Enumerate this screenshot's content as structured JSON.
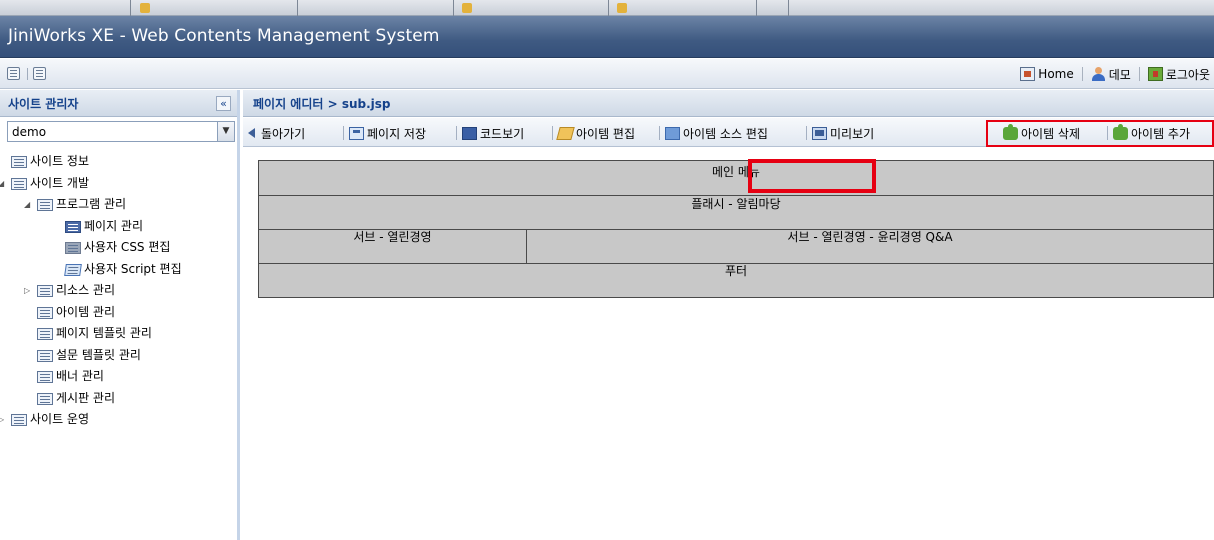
{
  "window": {
    "title": "JiniWorks XE - Web Contents Management System"
  },
  "topnav": {
    "home": "Home",
    "user": "데모",
    "logout": "로그아웃"
  },
  "left_panel": {
    "title": "사이트 관리자",
    "site_select": {
      "value": "demo"
    },
    "tree": [
      {
        "label": "사이트 정보",
        "level": 0,
        "expander": "none",
        "icon": "list-icon"
      },
      {
        "label": "사이트 개발",
        "level": 0,
        "expander": "expanded",
        "icon": "list-icon"
      },
      {
        "label": "프로그램 관리",
        "level": 1,
        "expander": "expanded",
        "icon": "list-icon"
      },
      {
        "label": "페이지 관리",
        "level": 2,
        "expander": "none",
        "icon": "page-icon"
      },
      {
        "label": "사용자 CSS 편집",
        "level": 2,
        "expander": "none",
        "icon": "css-icon"
      },
      {
        "label": "사용자 Script 편집",
        "level": 2,
        "expander": "none",
        "icon": "script-icon"
      },
      {
        "label": "리소스 관리",
        "level": 1,
        "expander": "collapsed",
        "icon": "list-icon"
      },
      {
        "label": "아이템 관리",
        "level": 1,
        "expander": "none",
        "icon": "list-icon"
      },
      {
        "label": "페이지 템플릿 관리",
        "level": 1,
        "expander": "none",
        "icon": "list-icon"
      },
      {
        "label": "설문 템플릿 관리",
        "level": 1,
        "expander": "none",
        "icon": "list-icon"
      },
      {
        "label": "배너 관리",
        "level": 1,
        "expander": "none",
        "icon": "list-icon"
      },
      {
        "label": "게시판 관리",
        "level": 1,
        "expander": "none",
        "icon": "list-icon"
      },
      {
        "label": "사이트 운영",
        "level": 0,
        "expander": "collapsed",
        "icon": "list-icon"
      }
    ]
  },
  "right_panel": {
    "title": "페이지 에디터 > sub.jsp",
    "toolbar": {
      "back": "돌아가기",
      "save": "페이지 저장",
      "code_view": "코드보기",
      "item_edit": "아이템 편집",
      "item_source_edit": "아이템 소스 편집",
      "preview": "미리보기",
      "item_delete": "아이템 삭제",
      "item_add": "아이템 추가"
    },
    "layout": {
      "main_menu": "메인 메뉴",
      "flash": "플래시 - 알림마당",
      "sub_left": "서브 - 열린경영",
      "sub_right": "서브 - 열린경영 - 윤리경영 Q&A",
      "footer": "푸터"
    }
  },
  "colors": {
    "title_bar": "#3f5a82",
    "panel_title_text": "#15428b",
    "highlight_box": "#e60012",
    "layout_block": "#c8c8c8"
  }
}
